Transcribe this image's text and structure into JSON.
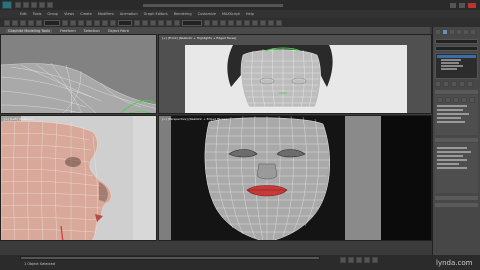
{
  "menu": {
    "items": [
      "Edit",
      "Tools",
      "Group",
      "Views",
      "Create",
      "Modifiers",
      "Animation",
      "Graph Editors",
      "Rendering",
      "Customize",
      "MAXScript",
      "Help"
    ]
  },
  "ribbon": {
    "tabs": [
      "Graphite Modeling Tools",
      "Freeform",
      "Selection",
      "Object Paint"
    ]
  },
  "viewports": {
    "top_right_label": "[+] [Front] [Realistic + Highlights + Edged Faces]",
    "bottom_left_label": "[+] [Left] [Realistic]",
    "bottom_right_label": "[+] [Perspective] [Realistic + Edged Faces]"
  },
  "status": {
    "selection": "1 Object Selected",
    "watermark": "lynda.com"
  },
  "colors": {
    "accent": "#3a6ea5",
    "lips": "#c83a3a",
    "selected_vertex": "#37d83a"
  }
}
